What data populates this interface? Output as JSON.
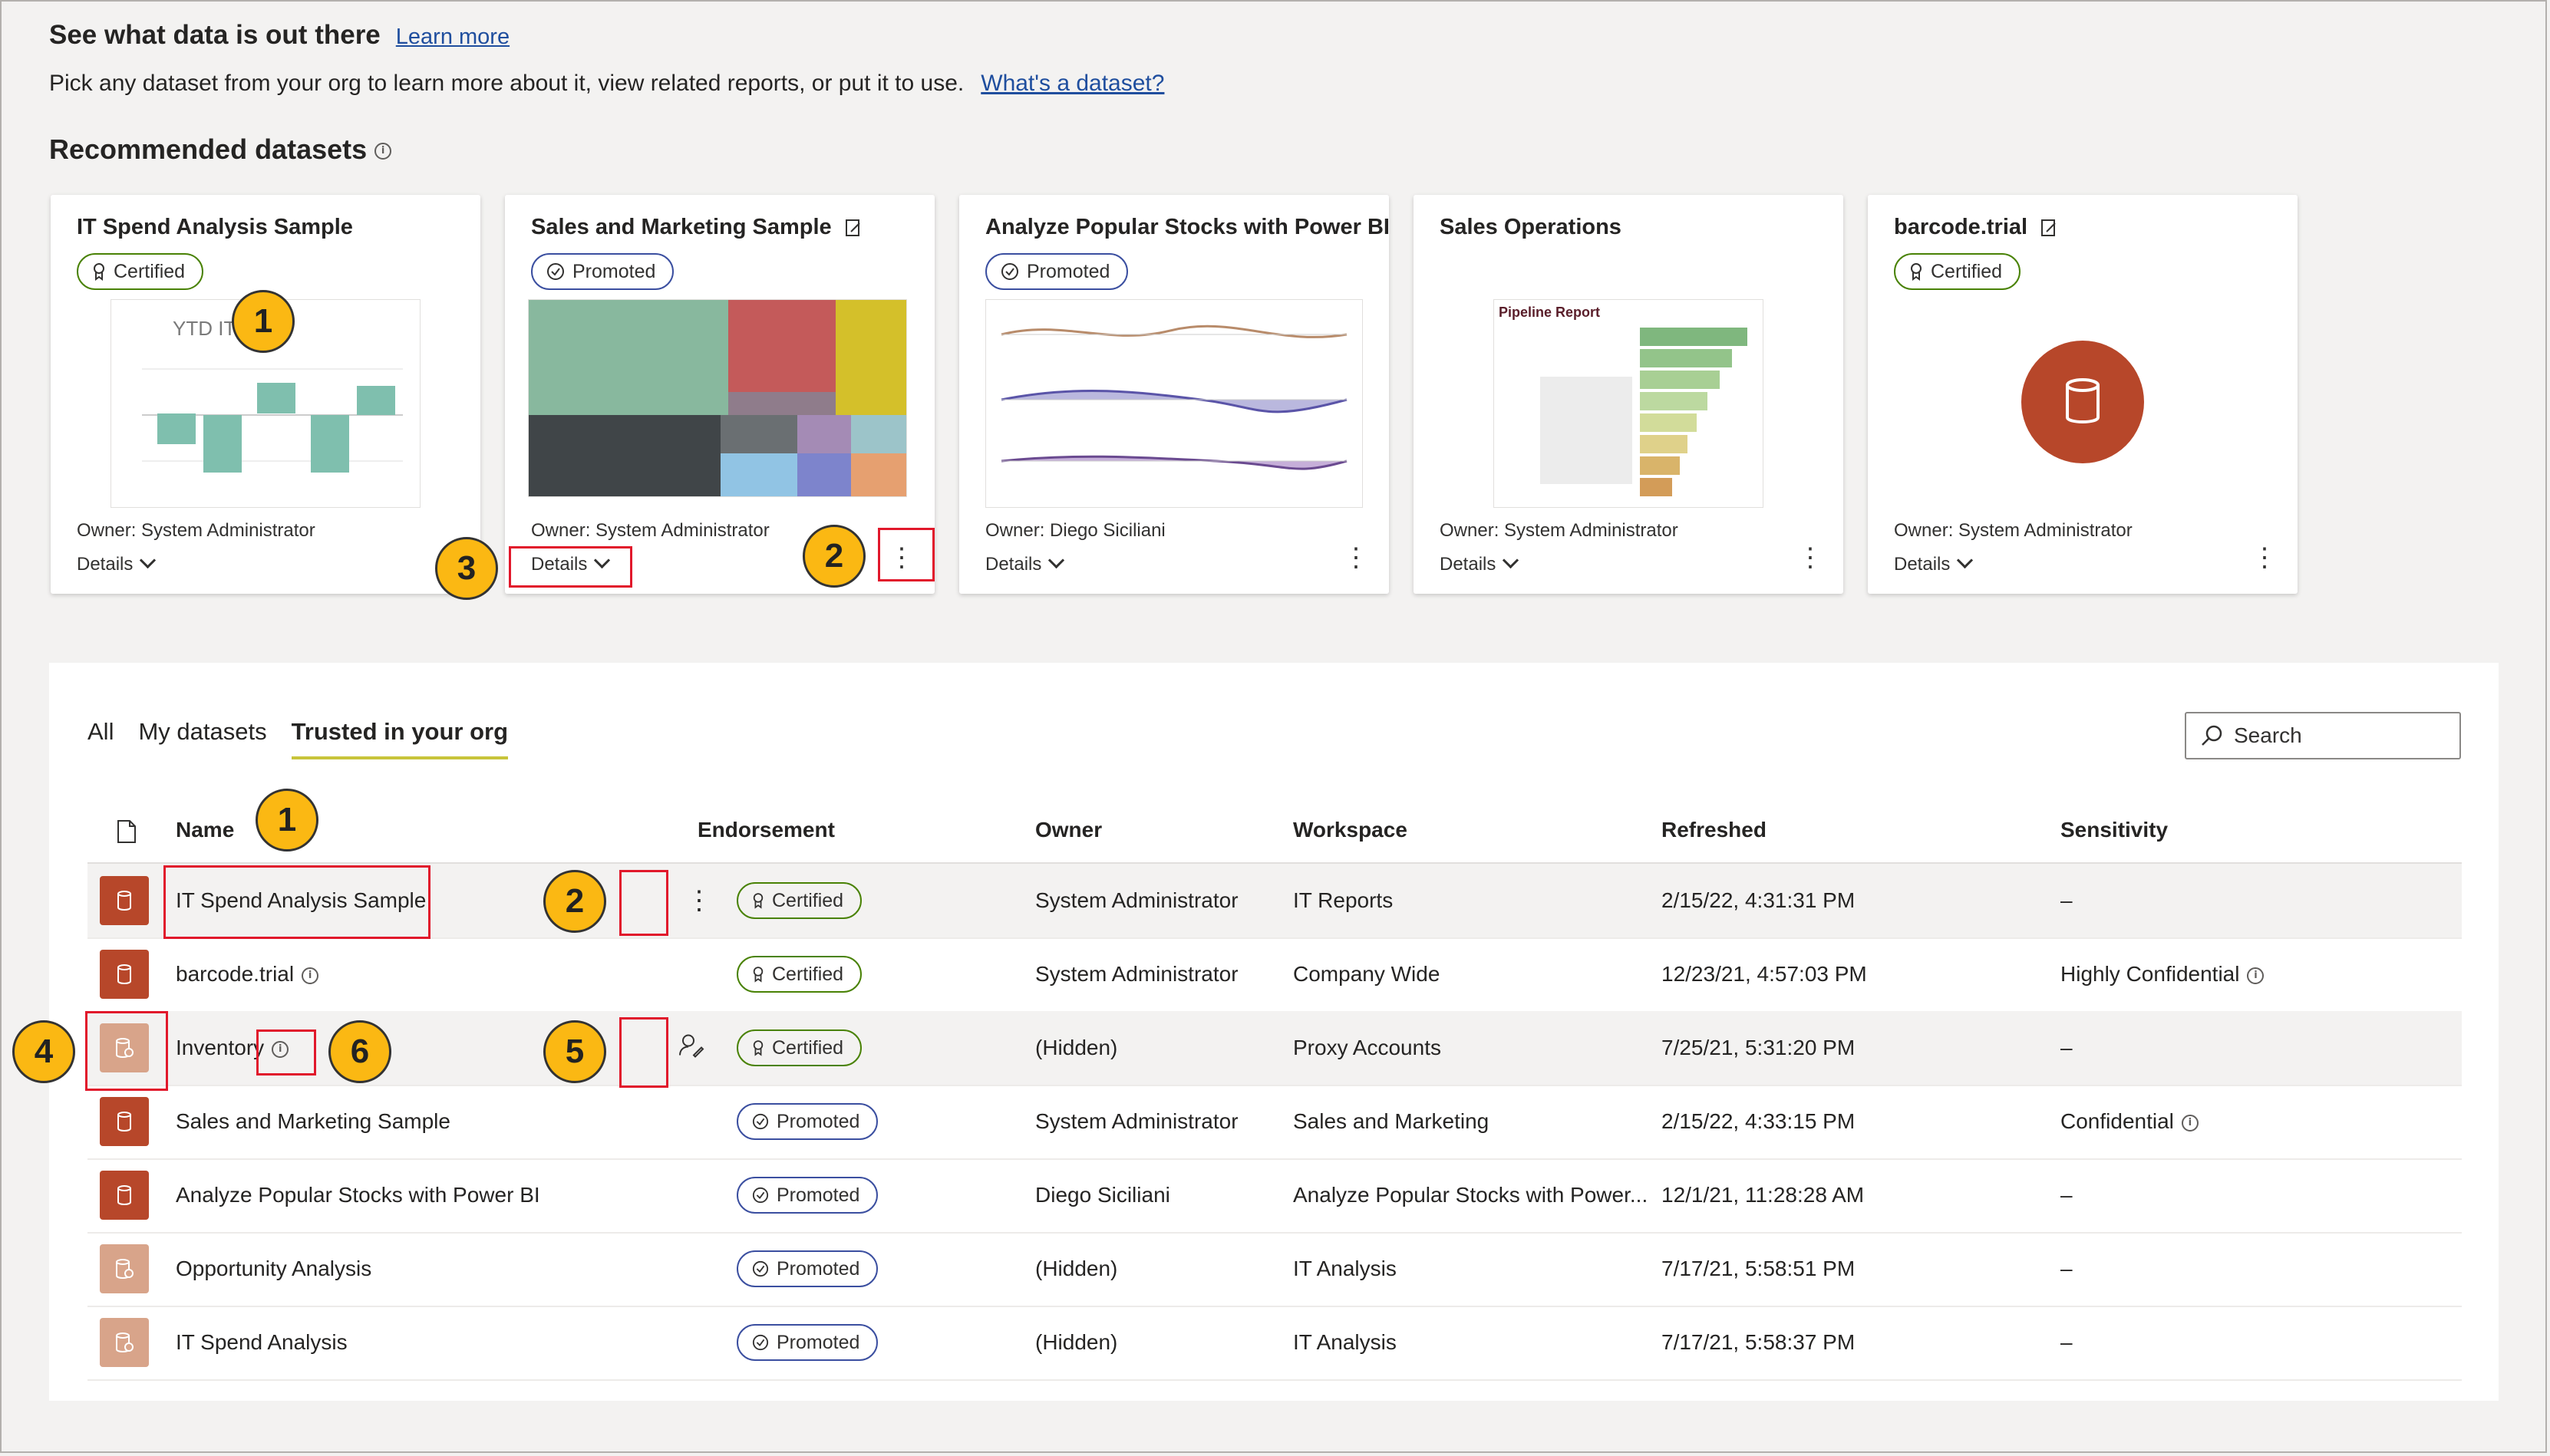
{
  "header": {
    "title": "See what data is out there",
    "learn_more": "Learn more",
    "subtitle": "Pick any dataset from your org to learn more about it, view related reports, or put it to use.",
    "whats_dataset": "What's a dataset?"
  },
  "recommended": {
    "title": "Recommended datasets",
    "cards": [
      {
        "title": "IT Spend Analysis Sample",
        "badge": "Certified",
        "owner": "Owner: System Administrator",
        "details": "Details",
        "thumb_text": "YTD IT Trend"
      },
      {
        "title": "Sales and Marketing Sample",
        "badge": "Promoted",
        "owner": "Owner: System Administrator",
        "details": "Details"
      },
      {
        "title": "Analyze Popular Stocks with Power BI",
        "badge": "Promoted",
        "owner": "Owner: Diego Siciliani",
        "details": "Details"
      },
      {
        "title": "Sales Operations",
        "owner": "Owner: System Administrator",
        "details": "Details",
        "thumb_text": "Pipeline Report"
      },
      {
        "title": "barcode.trial",
        "badge": "Certified",
        "owner": "Owner: System Administrator",
        "details": "Details"
      }
    ]
  },
  "tabs": [
    "All",
    "My datasets",
    "Trusted in your org"
  ],
  "search": {
    "label": "Search"
  },
  "table": {
    "headers": [
      "Name",
      "Endorsement",
      "Owner",
      "Workspace",
      "Refreshed",
      "Sensitivity"
    ],
    "rows": [
      {
        "name": "IT Spend Analysis Sample",
        "endorsement": "Certified",
        "owner": "System Administrator",
        "workspace": "IT Reports",
        "refreshed": "2/15/22, 4:31:31 PM",
        "sensitivity": "–"
      },
      {
        "name": "barcode.trial",
        "endorsement": "Certified",
        "owner": "System Administrator",
        "workspace": "Company Wide",
        "refreshed": "12/23/21, 4:57:03 PM",
        "sensitivity": "Highly Confidential"
      },
      {
        "name": "Inventory",
        "endorsement": "Certified",
        "owner": "(Hidden)",
        "workspace": "Proxy Accounts",
        "refreshed": "7/25/21, 5:31:20 PM",
        "sensitivity": "–"
      },
      {
        "name": "Sales and Marketing Sample",
        "endorsement": "Promoted",
        "owner": "System Administrator",
        "workspace": "Sales and Marketing",
        "refreshed": "2/15/22, 4:33:15 PM",
        "sensitivity": "Confidential"
      },
      {
        "name": "Analyze Popular Stocks with Power BI",
        "endorsement": "Promoted",
        "owner": "Diego Siciliani",
        "workspace": "Analyze Popular Stocks with Power...",
        "refreshed": "12/1/21, 11:28:28 AM",
        "sensitivity": "–"
      },
      {
        "name": "Opportunity Analysis",
        "endorsement": "Promoted",
        "owner": "(Hidden)",
        "workspace": "IT Analysis",
        "refreshed": "7/17/21, 5:58:51 PM",
        "sensitivity": "–"
      },
      {
        "name": "IT Spend Analysis",
        "endorsement": "Promoted",
        "owner": "(Hidden)",
        "workspace": "IT Analysis",
        "refreshed": "7/17/21, 5:58:37 PM",
        "sensitivity": "–"
      }
    ]
  },
  "callouts": [
    "1",
    "2",
    "3",
    "1",
    "2",
    "4",
    "6",
    "5"
  ],
  "colors": {
    "certified": "#498205",
    "promoted": "#3b4fa0",
    "dataset_icon": "#b7472a",
    "dataset_icon_light": "#d8a48a",
    "callout": "#fbb813",
    "highlight_box": "#e1182b"
  }
}
